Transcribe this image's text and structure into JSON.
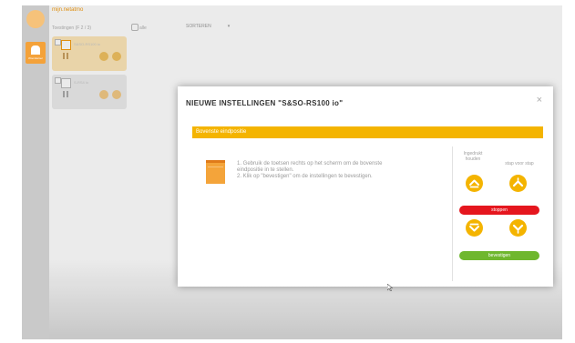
{
  "app": {
    "brand": "mijn.netatmo",
    "toolbar": {
      "selection_text": "Toestingen (F 2 / 3)",
      "select_all_label": "alle",
      "sort_label": "SORTEREN"
    },
    "sidebar": {
      "home_label": "Woonkamer"
    },
    "devices": [
      {
        "name": "S&SO-RS100 io"
      },
      {
        "name": "S-RS4 io"
      }
    ]
  },
  "modal": {
    "title": "NIEUWE INSTELLINGEN \"S&SO-RS100 io\"",
    "close": "×",
    "section": "Bovenste eindpositie",
    "instructions": [
      "1. Gebruik de toetsen rechts op het scherm om de bovenste",
      "eindpositie in te stellen.",
      "2. Klik op \"bevestigen\" om de instellingen te bevestigen."
    ],
    "controls": {
      "hold_label_1": "Ingedrukt",
      "hold_label_2": "houden",
      "step_label": "stap voor stap",
      "stop_label": "stoppen",
      "confirm_label": "bevestigen"
    }
  },
  "colors": {
    "accent": "#f4b400",
    "stop": "#e5161e",
    "confirm": "#6fb72e",
    "brand": "#f39c12"
  }
}
